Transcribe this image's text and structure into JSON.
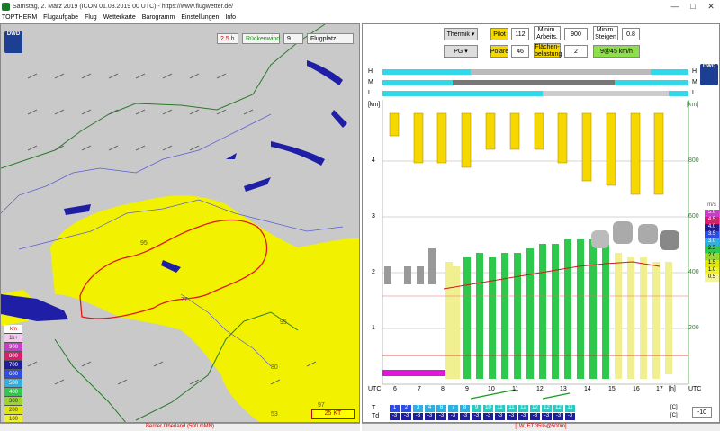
{
  "window": {
    "title": "Samstag, 2. März 2019 (ICON 01.03.2019 00 UTC) - https://www.flugwetter.de/",
    "minimize": "—",
    "maximize": "□",
    "close": "✕"
  },
  "menu": [
    "TOPTHERM",
    "Flugaufgabe",
    "Flug",
    "Wetterkarte",
    "Barogramm",
    "Einstellungen",
    "Info"
  ],
  "map": {
    "time_label": "2.5 h",
    "wind_checkbox_label": "Rückenwind",
    "wind_value": "9",
    "location_select": "Flugplatz",
    "logo_text": "DWD",
    "scale_label": "25 KT",
    "contour_labels": [
      "95",
      "77",
      "95",
      "80",
      "97",
      "53"
    ],
    "legend_title": "km",
    "legend": [
      {
        "label": "1k+",
        "color": "#f3c9ef"
      },
      {
        "label": "900",
        "color": "#c83cc8"
      },
      {
        "label": "800",
        "color": "#d61e6a"
      },
      {
        "label": "700",
        "color": "#1e1e9a"
      },
      {
        "label": "600",
        "color": "#2b4ce6"
      },
      {
        "label": "500",
        "color": "#30b0e0"
      },
      {
        "label": "400",
        "color": "#2ec84c"
      },
      {
        "label": "300",
        "color": "#9ad62a"
      },
      {
        "label": "200",
        "color": "#e0e800"
      },
      {
        "label": "100",
        "color": "#f0f030"
      }
    ],
    "status": "Berner Oberland (500 mMN)"
  },
  "controls": {
    "mode_select": "Thermik",
    "pilot_label": "Pilot",
    "pilot_value": "112",
    "min_arbeit_label": "Minim. Arbeits.",
    "min_arbeit_value": "900",
    "min_steigen_label": "Minim. Steigen",
    "min_steigen_value": "0.8",
    "glider_select": "PG",
    "polare_label": "Polare",
    "polare_value": "46",
    "flaechen_label": "Flächen- belastung",
    "flaechen_value": "2",
    "speed_value": "9@45 km/h"
  },
  "profile": {
    "cloud_rows": [
      "H",
      "M",
      "L"
    ],
    "y_left_label": "[km]",
    "y_right_label": "[km]",
    "km_ticks": [
      "4",
      "3",
      "2",
      "1"
    ],
    "right_ticks": [
      "800",
      "600",
      "400",
      "200"
    ],
    "x_ticks": [
      "UTC",
      "6",
      "7",
      "8",
      "9",
      "10",
      "11",
      "12",
      "13",
      "14",
      "15",
      "16",
      "17",
      "[h]",
      "UTC"
    ],
    "ms_legend_title": "m/s",
    "ms_legend": [
      {
        "label": "5.0",
        "color": "#c83cc8"
      },
      {
        "label": "4.5",
        "color": "#d61e6a"
      },
      {
        "label": "4.0",
        "color": "#1e1e9a"
      },
      {
        "label": "3.5",
        "color": "#2b4ce6"
      },
      {
        "label": "3.0",
        "color": "#30b0e0"
      },
      {
        "label": "2.5",
        "color": "#2ec84c"
      },
      {
        "label": "2.0",
        "color": "#9ad62a"
      },
      {
        "label": "1.5",
        "color": "#e0e800"
      },
      {
        "label": "1.0",
        "color": "#f0f030"
      },
      {
        "label": "0.5",
        "color": "#f4f49a"
      }
    ],
    "t_row_label": "T",
    "td_row_label": "Td",
    "unit_c": "[C]",
    "t_values": [
      "1",
      "2",
      "3",
      "4",
      "6",
      "7",
      "8",
      "9",
      "10",
      "11",
      "11",
      "12",
      "12",
      "12",
      "12",
      "11"
    ],
    "td_values": [
      "-3",
      "-3",
      "-3",
      "-3",
      "-3",
      "-3",
      "-3",
      "-3",
      "-3",
      "-3",
      "-3",
      "-3",
      "-3",
      "-3",
      "-3",
      "-3"
    ],
    "offset_select": "-10",
    "status": "[LW, ET 35%@500m]"
  }
}
